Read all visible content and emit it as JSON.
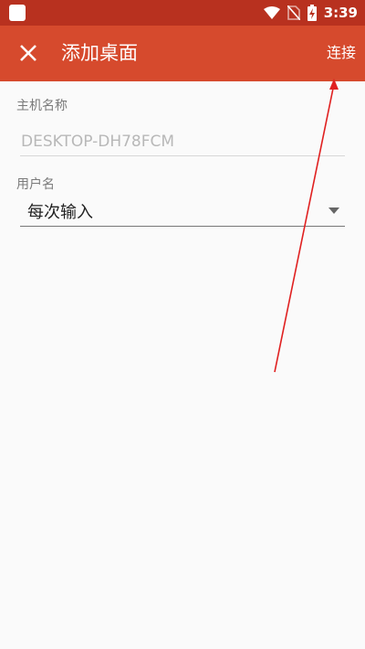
{
  "status_bar": {
    "time": "3:39"
  },
  "toolbar": {
    "title": "添加桌面",
    "action_label": "连接"
  },
  "form": {
    "host_label": "主机名称",
    "host_placeholder": "DESKTOP-DH78FCM",
    "user_label": "用户名",
    "user_selected": "每次输入"
  },
  "colors": {
    "toolbar": "#d64a2d",
    "status_bar": "#b8311f",
    "annotation_arrow": "#e02020"
  }
}
